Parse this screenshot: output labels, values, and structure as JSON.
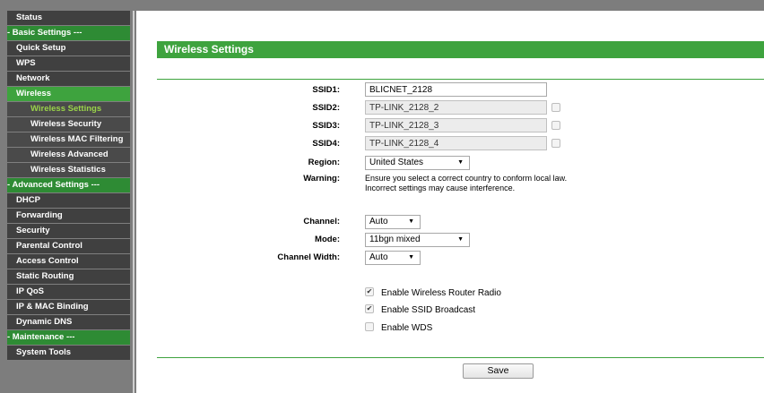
{
  "sidebar": {
    "items": [
      {
        "label": "Status",
        "kind": "top"
      },
      {
        "label": "- Basic Settings ---",
        "kind": "section"
      },
      {
        "label": "Quick Setup",
        "kind": "top"
      },
      {
        "label": "WPS",
        "kind": "top"
      },
      {
        "label": "Network",
        "kind": "top"
      },
      {
        "label": "Wireless",
        "kind": "top-active"
      },
      {
        "label": "Wireless Settings",
        "kind": "sub-active"
      },
      {
        "label": "Wireless Security",
        "kind": "sub"
      },
      {
        "label": "Wireless MAC Filtering",
        "kind": "sub"
      },
      {
        "label": "Wireless Advanced",
        "kind": "sub"
      },
      {
        "label": "Wireless Statistics",
        "kind": "sub"
      },
      {
        "label": "- Advanced Settings ---",
        "kind": "section"
      },
      {
        "label": "DHCP",
        "kind": "top"
      },
      {
        "label": "Forwarding",
        "kind": "top"
      },
      {
        "label": "Security",
        "kind": "top"
      },
      {
        "label": "Parental Control",
        "kind": "top"
      },
      {
        "label": "Access Control",
        "kind": "top"
      },
      {
        "label": "Static Routing",
        "kind": "top"
      },
      {
        "label": "IP QoS",
        "kind": "top"
      },
      {
        "label": "IP & MAC Binding",
        "kind": "top"
      },
      {
        "label": "Dynamic DNS",
        "kind": "top"
      },
      {
        "label": "- Maintenance ---",
        "kind": "section"
      },
      {
        "label": "System Tools",
        "kind": "top"
      }
    ]
  },
  "page": {
    "title": "Wireless Settings"
  },
  "form": {
    "ssid1": {
      "label": "SSID1:",
      "value": "BLICNET_2128"
    },
    "ssid2": {
      "label": "SSID2:",
      "value": "TP-LINK_2128_2"
    },
    "ssid3": {
      "label": "SSID3:",
      "value": "TP-LINK_2128_3"
    },
    "ssid4": {
      "label": "SSID4:",
      "value": "TP-LINK_2128_4"
    },
    "region": {
      "label": "Region:",
      "value": "United States"
    },
    "warning": {
      "label": "Warning:",
      "line1": "Ensure you select a correct country to conform local law.",
      "line2": "Incorrect settings may cause interference."
    },
    "channel": {
      "label": "Channel:",
      "value": "Auto"
    },
    "mode": {
      "label": "Mode:",
      "value": "11bgn mixed"
    },
    "channel_width": {
      "label": "Channel Width:",
      "value": "Auto"
    },
    "options": [
      {
        "label": "Enable Wireless Router Radio",
        "checked": true
      },
      {
        "label": "Enable SSID Broadcast",
        "checked": true
      },
      {
        "label": "Enable WDS",
        "checked": false
      }
    ],
    "save_label": "Save"
  },
  "colors": {
    "accent_green": "#3ea33e",
    "section_green": "#2e8b34",
    "sidebar_dark": "#404040",
    "active_sub_text": "#9ad44a"
  }
}
